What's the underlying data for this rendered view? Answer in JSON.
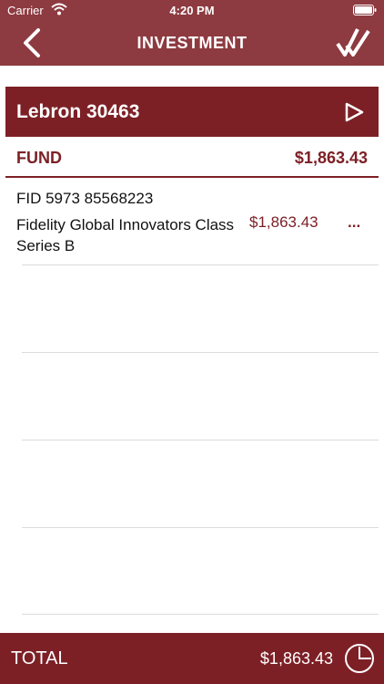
{
  "status_bar": {
    "carrier": "Carrier",
    "time": "4:20 PM"
  },
  "nav": {
    "title": "INVESTMENT",
    "back_icon": "chevron-left-icon",
    "confirm_icon": "double-check-icon"
  },
  "account": {
    "name": "Lebron 30463",
    "action_icon": "play-outline-icon"
  },
  "fund_section": {
    "label": "FUND",
    "value": "$1,863.43"
  },
  "holdings": [
    {
      "fid": "FID 5973 85568223",
      "name": "Fidelity Global Innovators Class Series B",
      "amount": "$1,863.43",
      "more": "..."
    }
  ],
  "total": {
    "label": "TOTAL",
    "value": "$1,863.43",
    "icon": "pie-chart-icon"
  },
  "colors": {
    "nav": "#8d3a40",
    "accent": "#7d2026",
    "text": "#111111"
  }
}
